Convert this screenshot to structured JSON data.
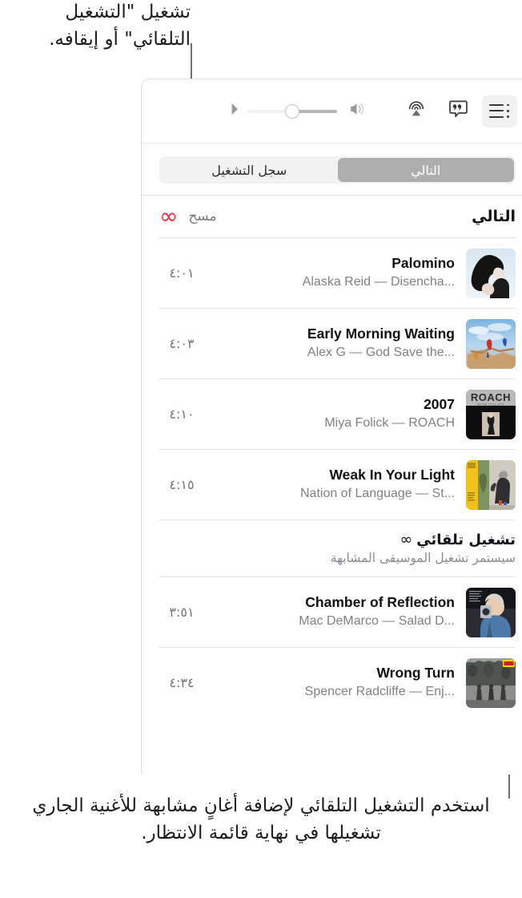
{
  "callouts": {
    "top": "تشغيل \"التشغيل التلقائي\" أو إيقافه.",
    "bottom": "استخدم التشغيل التلقائي لإضافة أغانٍ مشابهة للأغنية الجاري تشغيلها في نهاية قائمة الانتظار."
  },
  "toolbar": {
    "queue_icon": "queue-list-icon",
    "lyrics_icon": "lyrics-quote-icon",
    "airplay_icon": "airplay-icon",
    "volume_low_icon": "speaker-wave-icon",
    "volume_high_icon": "speaker-triangle-icon",
    "volume_percent": 50
  },
  "tabs": [
    {
      "label": "التالي",
      "selected": true
    },
    {
      "label": "سجل التشغيل",
      "selected": false
    }
  ],
  "queue_header": {
    "title": "التالي",
    "clear_label": "مسح",
    "infinity_glyph": "∞",
    "infinity_color": "#fa233b"
  },
  "tracks": [
    {
      "title": "Palomino",
      "subtitle": "Alaska Reid — Disencha...",
      "duration": "٤:٠١",
      "artwork": "alaska-reid-disenchanter-artwork"
    },
    {
      "title": "Early Morning Waiting",
      "subtitle": "Alex G — God Save the...",
      "duration": "٤:٠٣",
      "artwork": "alex-g-god-save-the-animals-artwork"
    },
    {
      "title": "2007",
      "subtitle": "Miya Folick — ROACH",
      "duration": "٤:١٠",
      "artwork": "miya-folick-roach-artwork"
    },
    {
      "title": "Weak In Your Light",
      "subtitle": "Nation of Language — St...",
      "duration": "٤:١٥",
      "artwork": "nation-of-language-strange-disciple-artwork"
    }
  ],
  "autoplay": {
    "infinity_glyph": "∞",
    "title": "تشغيل تلقائي",
    "subtitle": "سيستمر تشغيل الموسيقى المشابهة"
  },
  "autoplay_tracks": [
    {
      "title": "Chamber of Reflection",
      "subtitle": "Mac DeMarco — Salad D...",
      "duration": "٣:٥١",
      "artwork": "mac-demarco-salad-days-artwork"
    },
    {
      "title": "Wrong Turn",
      "subtitle": "Spencer Radcliffe — Enj...",
      "duration": "٤:٣٤",
      "artwork": "spencer-radcliffe-enjoy-the-great-outdoors-artwork"
    }
  ]
}
